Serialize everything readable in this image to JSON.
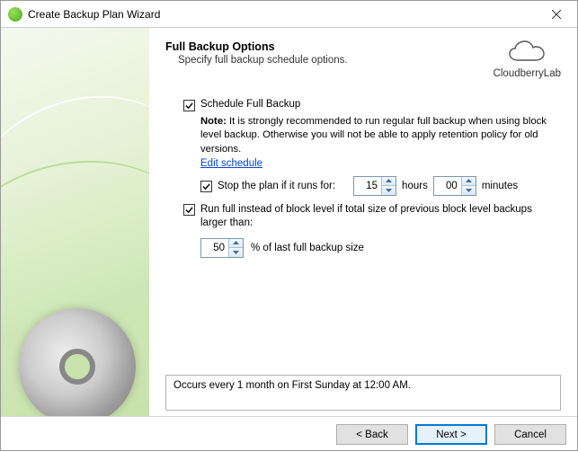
{
  "window": {
    "title": "Create Backup Plan Wizard"
  },
  "header": {
    "title": "Full Backup Options",
    "subtitle": "Specify full backup schedule options.",
    "brand": "CloudberryLab"
  },
  "schedule_full": {
    "label": "Schedule Full Backup",
    "checked": true,
    "note_label": "Note:",
    "note_text": "It is strongly recommended to run regular full backup when using block level backup. Otherwise you will not be able to apply retention policy for old versions.",
    "edit_link": "Edit schedule"
  },
  "stop_plan": {
    "checked": true,
    "label_prefix": "Stop the plan if it runs for:",
    "hours_value": "15",
    "hours_label": "hours",
    "minutes_value": "00",
    "minutes_label": "minutes"
  },
  "run_full": {
    "checked": true,
    "label": "Run full instead of block level if total size of previous block level backups larger than:",
    "percent_value": "50",
    "percent_suffix": "% of last full backup size"
  },
  "schedule_summary": "Occurs every 1 month on First Sunday at 12:00 AM.",
  "buttons": {
    "back": "< Back",
    "next": "Next >",
    "cancel": "Cancel"
  }
}
